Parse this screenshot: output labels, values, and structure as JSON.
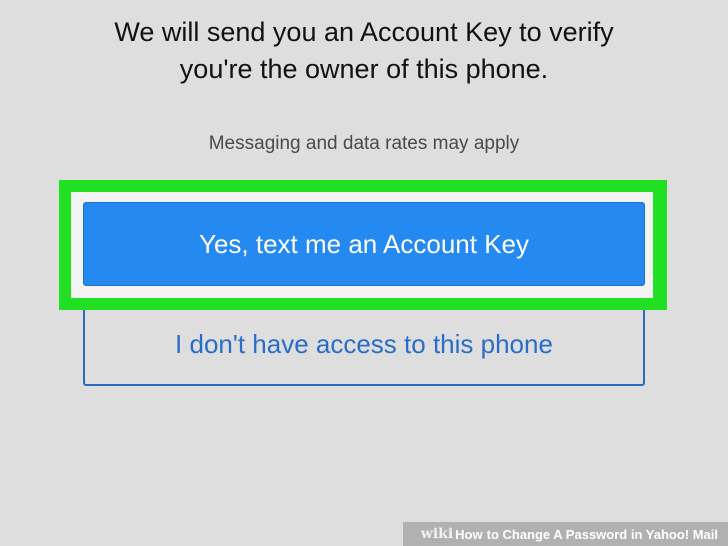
{
  "message": {
    "headline": "We will send you an Account Key to verify\nyou're the owner of this phone.",
    "note": "Messaging and data rates may apply"
  },
  "buttons": {
    "primary_label": "Yes, text me an Account Key",
    "secondary_label": "I don't have access to this phone"
  },
  "watermark": {
    "wiki": "wiki",
    "how": "How",
    "title": "to Change A Password in Yahoo! Mail"
  },
  "colors": {
    "background": "#dedede",
    "primary_button": "#2489f0",
    "secondary_border": "#2a69c4",
    "highlight": "#21e024"
  }
}
